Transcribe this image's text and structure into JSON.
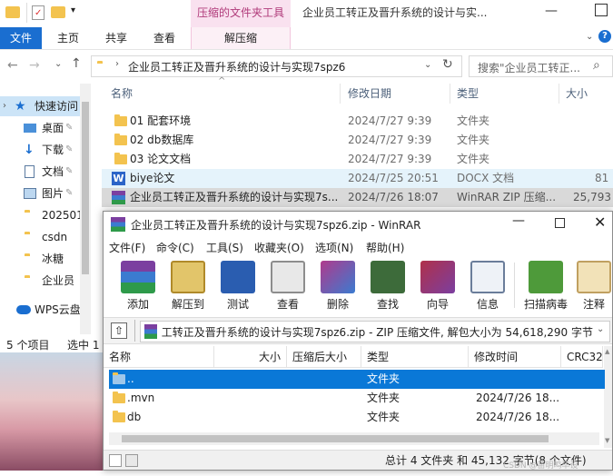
{
  "explorer": {
    "context_tab": "压缩的文件夹工具",
    "window_title": "企业员工转正及晋升系统的设计与实...",
    "tabs": [
      "文件",
      "主页",
      "共享",
      "查看",
      "解压缩"
    ],
    "address": "企业员工转正及晋升系统的设计与实现7spz6",
    "search_placeholder": "搜索\"企业员工转正...",
    "nav": [
      {
        "label": "快速访问",
        "kind": "star"
      },
      {
        "label": "桌面",
        "kind": "desktop"
      },
      {
        "label": "下载",
        "kind": "download"
      },
      {
        "label": "文档",
        "kind": "doc"
      },
      {
        "label": "图片",
        "kind": "pic"
      },
      {
        "label": "202501",
        "kind": "folder"
      },
      {
        "label": "csdn",
        "kind": "folder"
      },
      {
        "label": "冰糖",
        "kind": "folder"
      },
      {
        "label": "企业员",
        "kind": "folder"
      },
      {
        "label": "WPS云盘",
        "kind": "cloud"
      }
    ],
    "columns": {
      "name": "名称",
      "date": "修改日期",
      "type": "类型",
      "size": "大小"
    },
    "files": [
      {
        "name": "01 配套环境",
        "date": "2024/7/27 9:39",
        "type": "文件夹",
        "size": "",
        "kind": "folder"
      },
      {
        "name": "02 db数据库",
        "date": "2024/7/27 9:39",
        "type": "文件夹",
        "size": "",
        "kind": "folder"
      },
      {
        "name": "03 论文文档",
        "date": "2024/7/27 9:39",
        "type": "文件夹",
        "size": "",
        "kind": "folder"
      },
      {
        "name": "biye论文",
        "date": "2024/7/25 20:51",
        "type": "DOCX 文档",
        "size": "81",
        "kind": "docx"
      },
      {
        "name": "企业员工转正及晋升系统的设计与实现7s...",
        "date": "2024/7/26 18:07",
        "type": "WinRAR ZIP 压缩...",
        "size": "25,793",
        "kind": "zip"
      }
    ],
    "status_items": "5 个项目",
    "status_selected": "选中 1"
  },
  "winrar": {
    "title": "企业员工转正及晋升系统的设计与实现7spz6.zip - WinRAR",
    "menu": [
      "文件(F)",
      "命令(C)",
      "工具(S)",
      "收藏夹(O)",
      "选项(N)",
      "帮助(H)"
    ],
    "toolbar": [
      {
        "label": "添加",
        "icon": "add-icon",
        "color": "#7a3f8f"
      },
      {
        "label": "解压到",
        "icon": "extract-icon",
        "color": "#c9a441"
      },
      {
        "label": "测试",
        "icon": "test-icon",
        "color": "#2a5db0"
      },
      {
        "label": "查看",
        "icon": "view-icon",
        "color": "#8d8d8d"
      },
      {
        "label": "删除",
        "icon": "delete-icon",
        "color": "#b03a8c"
      },
      {
        "label": "查找",
        "icon": "find-icon",
        "color": "#3d6b3a"
      },
      {
        "label": "向导",
        "icon": "wizard-icon",
        "color": "#b0304a"
      },
      {
        "label": "信息",
        "icon": "info-icon",
        "color": "#6a7d9a"
      },
      {
        "label": "扫描病毒",
        "icon": "scan-virus-icon",
        "color": "#4e9a3a"
      },
      {
        "label": "注释",
        "icon": "comment-icon",
        "color": "#c0a060"
      }
    ],
    "path": "企业员工转正及晋升系统的设计与实现7spz6.zip - ZIP 压缩文件, 解包大小为 54,618,290 字节",
    "columns": {
      "name": "名称",
      "size": "大小",
      "packed": "压缩后大小",
      "type": "类型",
      "modified": "修改时间",
      "crc": "CRC32"
    },
    "rows": [
      {
        "name": "..",
        "size": "",
        "type": "文件夹",
        "modified": "",
        "selected": true
      },
      {
        "name": ".mvn",
        "size": "",
        "type": "文件夹",
        "modified": "2024/7/26 18..."
      },
      {
        "name": "db",
        "size": "",
        "type": "文件夹",
        "modified": "2024/7/26 18..."
      }
    ],
    "status": "总计 4 文件夹 和 45,132 字节(8 个文件)",
    "watermark": "CSDN @苗明鸣毕设"
  }
}
